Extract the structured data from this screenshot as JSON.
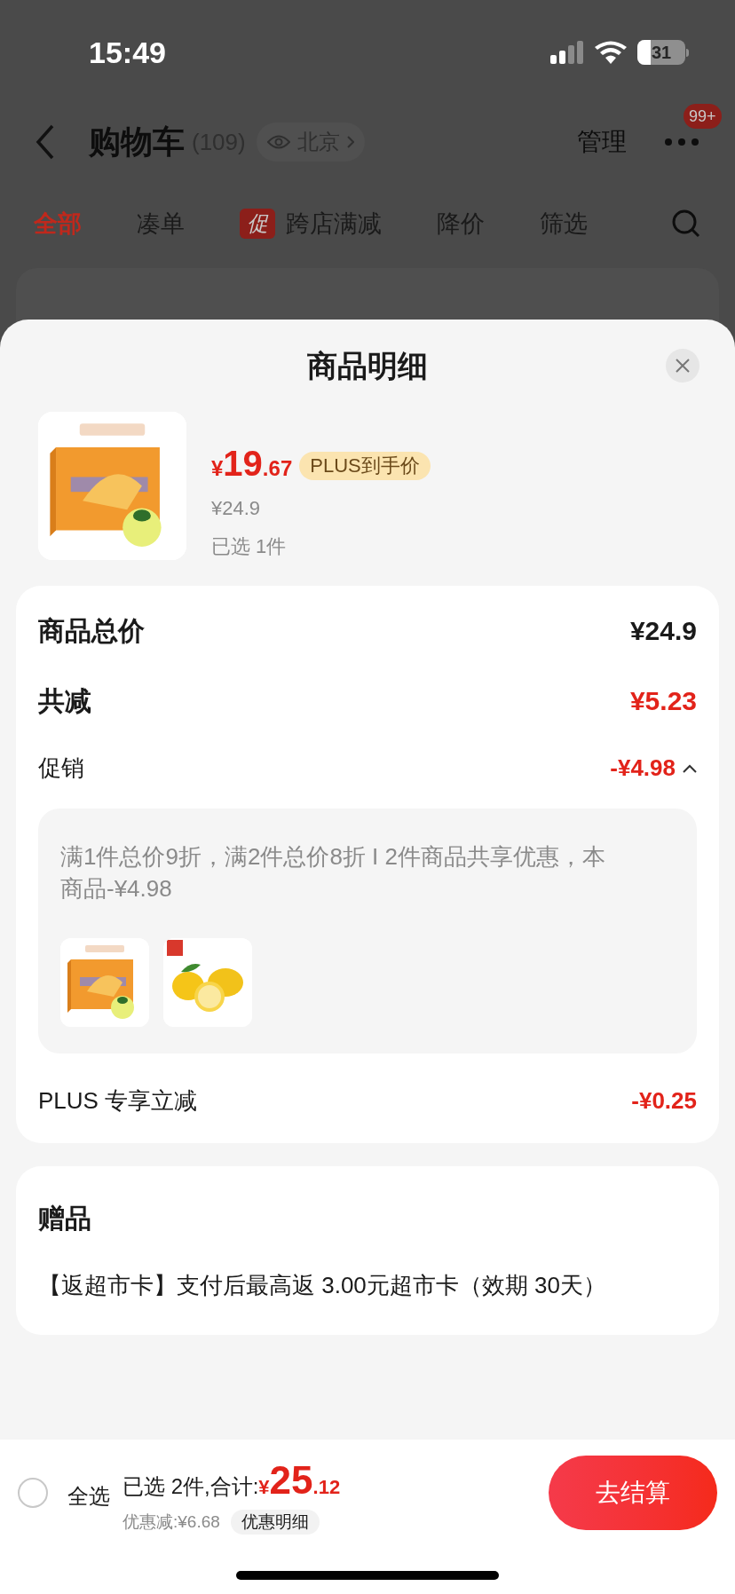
{
  "status_bar": {
    "time": "15:49",
    "battery": "31"
  },
  "nav": {
    "title": "购物车",
    "count": "(109)",
    "location": "北京",
    "manage": "管理",
    "badge": "99+"
  },
  "tabs": [
    {
      "label": "全部",
      "selected": true
    },
    {
      "label": "凑单",
      "selected": false
    },
    {
      "label": "跨店满减",
      "selected": false,
      "tag": "促"
    },
    {
      "label": "降价",
      "selected": false
    },
    {
      "label": "筛选",
      "selected": false
    }
  ],
  "sheet": {
    "title": "商品明细",
    "product": {
      "currency": "¥",
      "price_int": "19",
      "price_dec": ".67",
      "price_tag": "PLUS到手价",
      "original_price": "¥24.9",
      "selected_count": "已选 1件"
    },
    "summary": [
      {
        "kind": "total",
        "label": "商品总价",
        "value": "¥24.9"
      },
      {
        "kind": "saving",
        "label": "共减",
        "value": "¥5.23"
      },
      {
        "kind": "promo",
        "label": "促销",
        "value": "-¥4.98",
        "expanded": true,
        "detail": "满1件总价9折，满2件总价8折 I 2件商品共享优惠，本商品-¥4.98",
        "thumbs": [
          {
            "kind": "box"
          },
          {
            "kind": "lemon"
          }
        ]
      },
      {
        "kind": "plus",
        "label": "PLUS 专享立减",
        "value": "-¥0.25"
      }
    ],
    "gift": {
      "title": "赠品",
      "text": "【返超市卡】支付后最高返 3.00元超市卡（效期 30天）"
    }
  },
  "bottom_bar": {
    "select_all": {
      "label": "全选",
      "checked": false
    },
    "summary": "已选 2件,合计:",
    "currency": "¥",
    "total_int": "25",
    "total_dec": ".12",
    "saved": "优惠减:¥6.68",
    "detail_button": "优惠明细",
    "checkout": "去结算"
  }
}
